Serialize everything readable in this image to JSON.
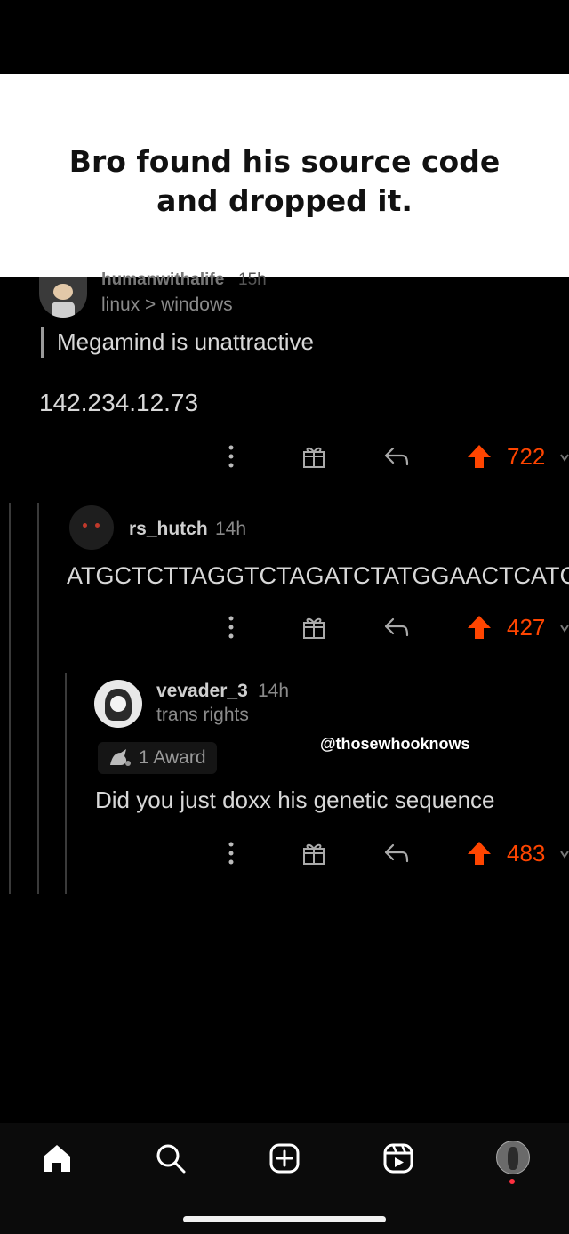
{
  "caption": "Bro found his source code and dropped it.",
  "watermark": "@thosewhooknows",
  "comments": [
    {
      "username": "humanwithalife",
      "age": "15h",
      "flair": "linux > windows",
      "quote": "Megamind is unattractive",
      "body": "142.234.12.73",
      "votes": "722"
    },
    {
      "username": "rs_hutch",
      "age": "14h",
      "body": "ATGCTCTTAGGTCTAGATCTATGGAACTCATCG",
      "votes": "427"
    },
    {
      "username": "vevader_3",
      "age": "14h",
      "flair": "trans rights",
      "award": "1 Award",
      "body": "Did you just doxx his genetic sequence",
      "votes": "483"
    }
  ],
  "icons": {
    "more": "more-vertical-icon",
    "award": "gift-icon",
    "reply": "reply-icon",
    "upvote": "upvote-arrow-icon",
    "downvote": "downvote-chevron-icon"
  },
  "colors": {
    "upvote": "#ff4500",
    "background": "#000000",
    "caption_bg": "#ffffff"
  },
  "nav": [
    "home-icon",
    "search-icon",
    "create-icon",
    "reels-icon",
    "profile-avatar"
  ]
}
